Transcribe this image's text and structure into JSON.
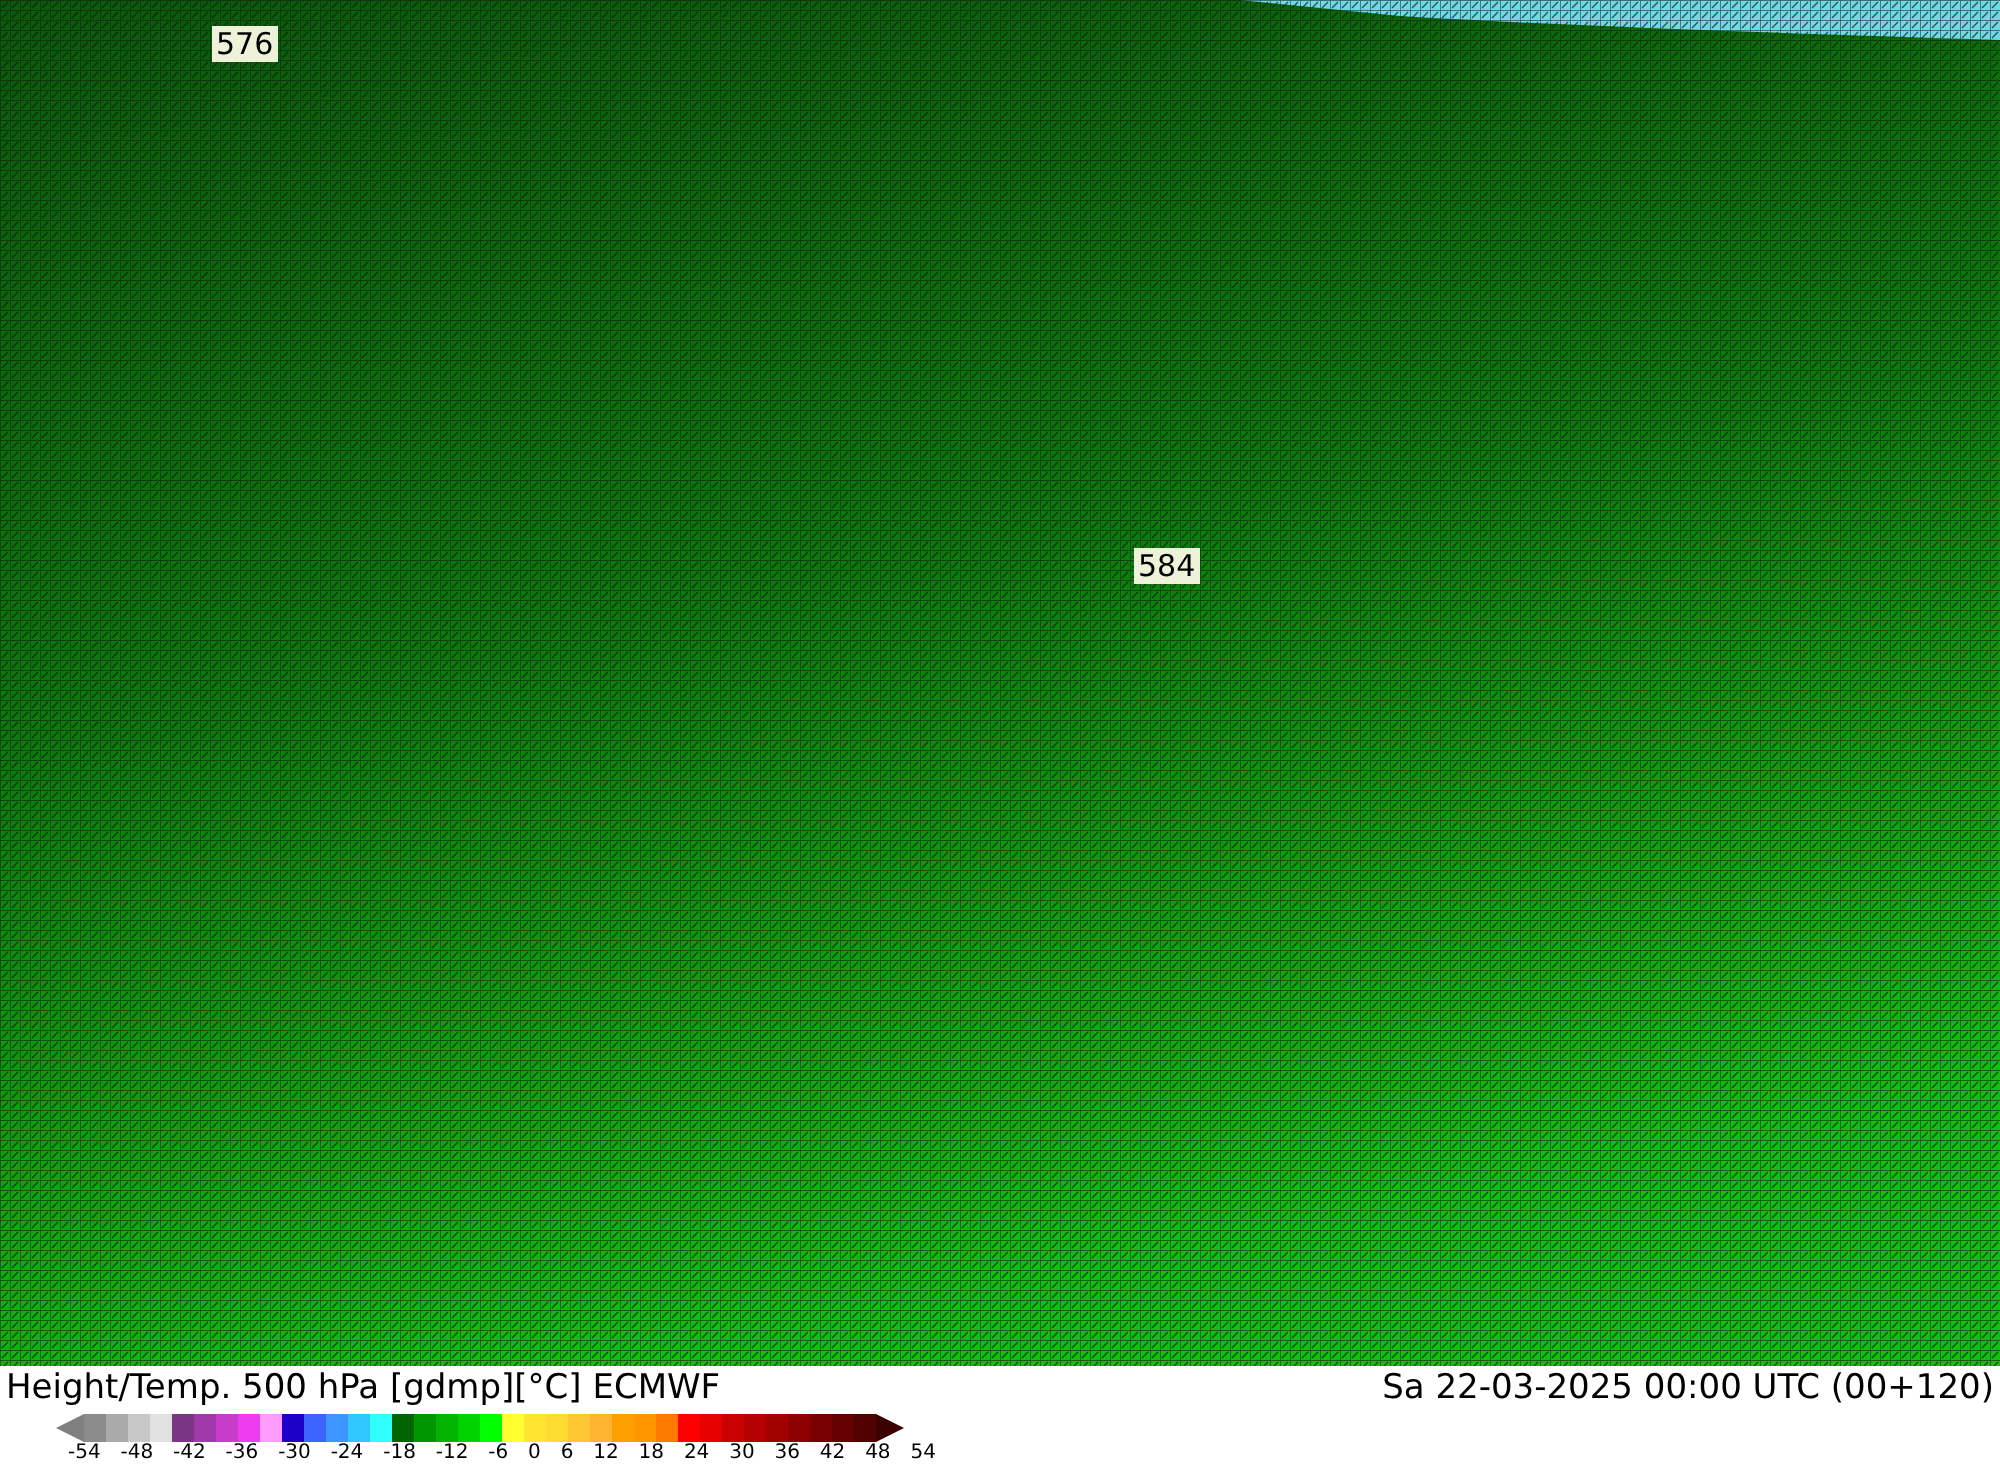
{
  "map": {
    "contour_labels": [
      "576",
      "584"
    ]
  },
  "footer": {
    "title": "Height/Temp. 500 hPa [gdmp][°C] ECMWF",
    "valid_time": "Sa 22-03-2025 00:00 UTC (00+120)"
  },
  "legend": {
    "ticks": [
      "-54",
      "-48",
      "-42",
      "-36",
      "-30",
      "-24",
      "-18",
      "-12",
      "-6",
      "0",
      "6",
      "12",
      "18",
      "24",
      "30",
      "36",
      "42",
      "48",
      "54"
    ]
  }
}
